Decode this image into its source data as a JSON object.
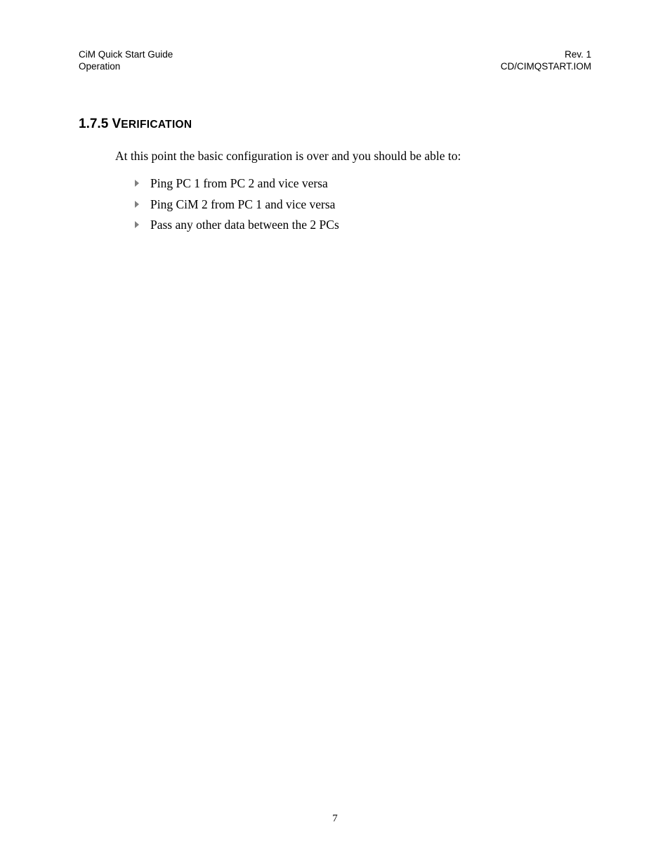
{
  "header": {
    "left1": "CiM Quick Start Guide",
    "left2": "Operation",
    "right1": "Rev. 1",
    "right2": "CD/CIMQSTART.IOM"
  },
  "section": {
    "number": "1.7.5",
    "title_lead": "V",
    "title_rest": "ERIFICATION"
  },
  "intro": "At this point the basic configuration is over and you should be able to:",
  "bullets": [
    "Ping PC 1 from PC 2 and vice versa",
    "Ping CiM 2 from PC 1 and vice versa",
    "Pass any other data between the 2 PCs"
  ],
  "page_number": "7"
}
